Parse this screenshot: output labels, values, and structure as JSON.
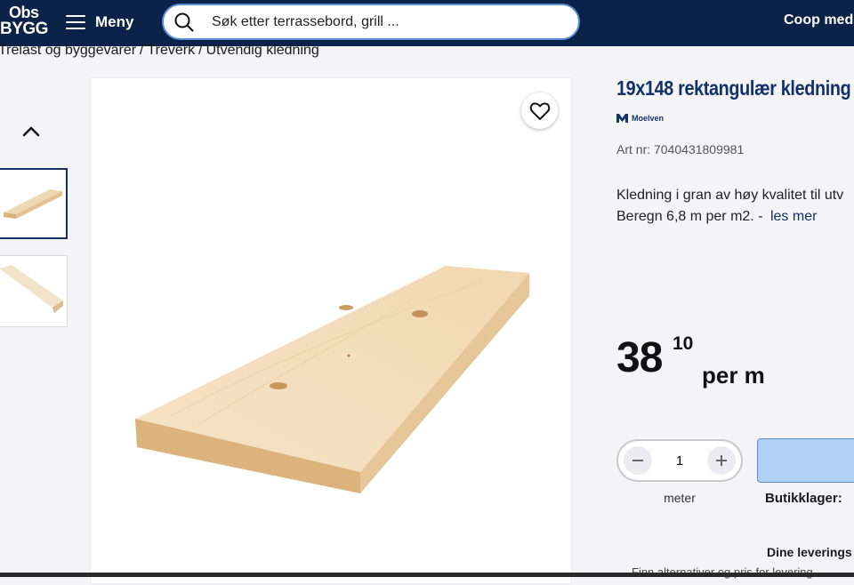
{
  "header": {
    "logo_line1": "Obs",
    "logo_line2": "BYGG",
    "menu_label": "Meny",
    "search_placeholder": "Søk etter terrassebord, grill ...",
    "coop_link": "Coop med"
  },
  "breadcrumb": [
    "Trelast og byggevarer",
    "Treverk",
    "Utvendig kledning"
  ],
  "breadcrumb_separator": "/",
  "product": {
    "title": "19x148 rektangulær kledning",
    "brand": "Moelven",
    "art_nr": "Art nr: 7040431809981",
    "description_line1": "Kledning i gran av høy kvalitet til utv",
    "description_line2": "Beregn 6,8 m per m2. -",
    "read_more": "les mer",
    "price_int": "38",
    "price_dec": "10",
    "price_unit": "per m",
    "quantity": "1",
    "quantity_unit": "meter",
    "stock_label": "Butikklager:",
    "delivery_label": "Dine leverings",
    "delivery_sub": "Finn alternativer og pris for levering"
  },
  "colors": {
    "header_bg": "#0b2348",
    "brand_blue": "#12316b",
    "add_button": "#aed1f3"
  }
}
